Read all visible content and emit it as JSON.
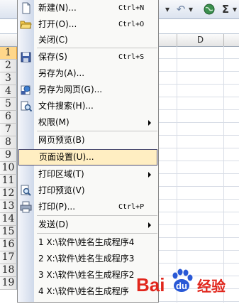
{
  "toolbar": {
    "undo_glyph": "↶",
    "sigma_glyph": "Σ",
    "dropdown_glyph": "▾"
  },
  "sheet": {
    "column_header": "D",
    "rows": [
      "1",
      "2",
      "3",
      "4",
      "5",
      "6",
      "7",
      "8",
      "9",
      "10",
      "11",
      "12",
      "13",
      "14",
      "15",
      "16",
      "17",
      "18",
      "19"
    ],
    "selected_row": "1"
  },
  "file_menu": {
    "items": [
      {
        "label": "新建(N)...",
        "shortcut": "Ctrl+N",
        "icon": "new-document-icon"
      },
      {
        "label": "打开(O)...",
        "shortcut": "Ctrl+O",
        "icon": "open-folder-icon"
      },
      {
        "label": "关闭(C)",
        "shortcut": "",
        "icon": ""
      },
      {
        "label": "保存(S)",
        "shortcut": "Ctrl+S",
        "icon": "save-disk-icon"
      },
      {
        "label": "另存为(A)...",
        "shortcut": "",
        "icon": ""
      },
      {
        "label": "另存为网页(G)...",
        "shortcut": "",
        "icon": "save-web-page-icon"
      },
      {
        "label": "文件搜索(H)...",
        "shortcut": "",
        "icon": "file-search-icon"
      },
      {
        "label": "权限(M)",
        "shortcut": "",
        "icon": "",
        "submenu": true
      },
      {
        "label": "网页预览(B)",
        "shortcut": "",
        "icon": ""
      },
      {
        "label": "页面设置(U)...",
        "shortcut": "",
        "icon": "",
        "highlighted": true
      },
      {
        "label": "打印区域(T)",
        "shortcut": "",
        "icon": "",
        "submenu": true
      },
      {
        "label": "打印预览(V)",
        "shortcut": "",
        "icon": "print-preview-icon"
      },
      {
        "label": "打印(P)...",
        "shortcut": "Ctrl+P",
        "icon": "printer-icon"
      },
      {
        "label": "发送(D)",
        "shortcut": "",
        "icon": "",
        "submenu": true
      },
      {
        "label": "1 X:\\软件\\姓名生成程序4",
        "shortcut": "",
        "icon": ""
      },
      {
        "label": "2 X:\\软件\\姓名生成程序3",
        "shortcut": "",
        "icon": ""
      },
      {
        "label": "3 X:\\软件\\姓名生成程序2",
        "shortcut": "",
        "icon": ""
      },
      {
        "label": "4 X:\\软件\\姓名生成程序",
        "shortcut": "",
        "icon": ""
      }
    ]
  },
  "watermark": {
    "brand": "Baidu",
    "suffix": "经验"
  }
}
